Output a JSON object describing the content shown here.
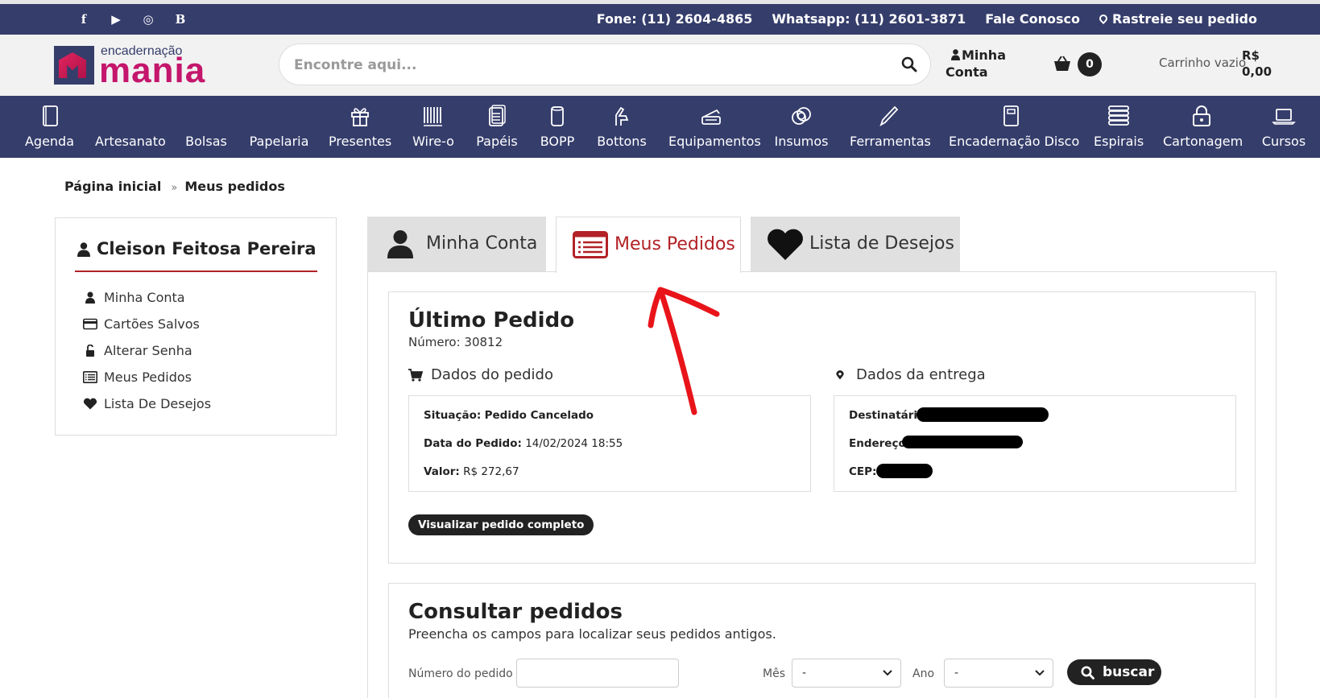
{
  "topbar": {
    "social": [
      "f",
      "▶",
      "◎",
      "B"
    ],
    "phone": "Fone: (11) 2604-4865",
    "whatsapp": "Whatsapp: (11) 2601-3871",
    "contact": "Fale Conosco",
    "track": "Rastreie seu pedido"
  },
  "header": {
    "logo_top": "encadernação",
    "logo_main": "mania",
    "search_placeholder": "Encontre aqui...",
    "account_line1": "Minha",
    "account_line2": "Conta",
    "cart_count": "0",
    "cart_empty": "Carrinho vazio",
    "cart_currency": "R$",
    "cart_total": "0,00"
  },
  "nav": {
    "items": [
      {
        "label": "Agenda",
        "icon": "notebook-icon"
      },
      {
        "label": "Artesanato",
        "icon": ""
      },
      {
        "label": "Bolsas",
        "icon": ""
      },
      {
        "label": "Papelaria",
        "icon": ""
      },
      {
        "label": "Presentes",
        "icon": "gift-icon"
      },
      {
        "label": "Wire-o",
        "icon": "wire-icon"
      },
      {
        "label": "Papéis",
        "icon": "papers-icon"
      },
      {
        "label": "BOPP",
        "icon": "roll-icon"
      },
      {
        "label": "Bottons",
        "icon": "button-press-icon"
      },
      {
        "label": "Equipamentos",
        "icon": "machine-icon"
      },
      {
        "label": "Insumos",
        "icon": "rings-icon"
      },
      {
        "label": "Ferramentas",
        "icon": "pen-icon"
      },
      {
        "label": "Encadernação Disco",
        "icon": "disc-notebook-icon"
      },
      {
        "label": "Espirais",
        "icon": "spiral-icon"
      },
      {
        "label": "Cartonagem",
        "icon": "lock-icon"
      },
      {
        "label": "Cursos",
        "icon": "laptop-icon"
      }
    ]
  },
  "breadcrumb": {
    "home": "Página inicial",
    "sep": "»",
    "current": "Meus pedidos"
  },
  "sidebar": {
    "user_name": "Cleison Feitosa Pereira",
    "items": [
      {
        "label": "Minha Conta",
        "icon": "user-icon"
      },
      {
        "label": "Cartões Salvos",
        "icon": "card-icon"
      },
      {
        "label": "Alterar Senha",
        "icon": "unlock-icon"
      },
      {
        "label": "Meus Pedidos",
        "icon": "list-icon"
      },
      {
        "label": "Lista De Desejos",
        "icon": "heart-icon"
      }
    ]
  },
  "tabs": [
    {
      "label": "Minha Conta",
      "active": false
    },
    {
      "label": "Meus Pedidos",
      "active": true
    },
    {
      "label": "Lista de Desejos",
      "active": false
    }
  ],
  "last_order": {
    "title": "Último Pedido",
    "number": "Número: 30812",
    "order_section": "Dados do pedido",
    "delivery_section": "Dados da entrega",
    "status_label": "Situação:",
    "status_value": "Pedido Cancelado",
    "date_label": "Data do Pedido:",
    "date_value": "14/02/2024 18:55",
    "value_label": "Valor:",
    "value_value": "R$ 272,67",
    "recipient_label": "Destinatário:",
    "address_label": "Endereço:",
    "cep_label": "CEP:",
    "view_button": "Visualizar pedido completo"
  },
  "query": {
    "title": "Consultar pedidos",
    "description": "Preencha os campos para localizar seus pedidos antigos.",
    "order_number_label": "Número do pedido",
    "month_label": "Mês",
    "month_value": "-",
    "year_label": "Ano",
    "year_value": "-",
    "search_button": "buscar"
  },
  "colors": {
    "navy": "#353d6b",
    "accent_red": "#b22226",
    "brand_pink": "#c4166c"
  }
}
